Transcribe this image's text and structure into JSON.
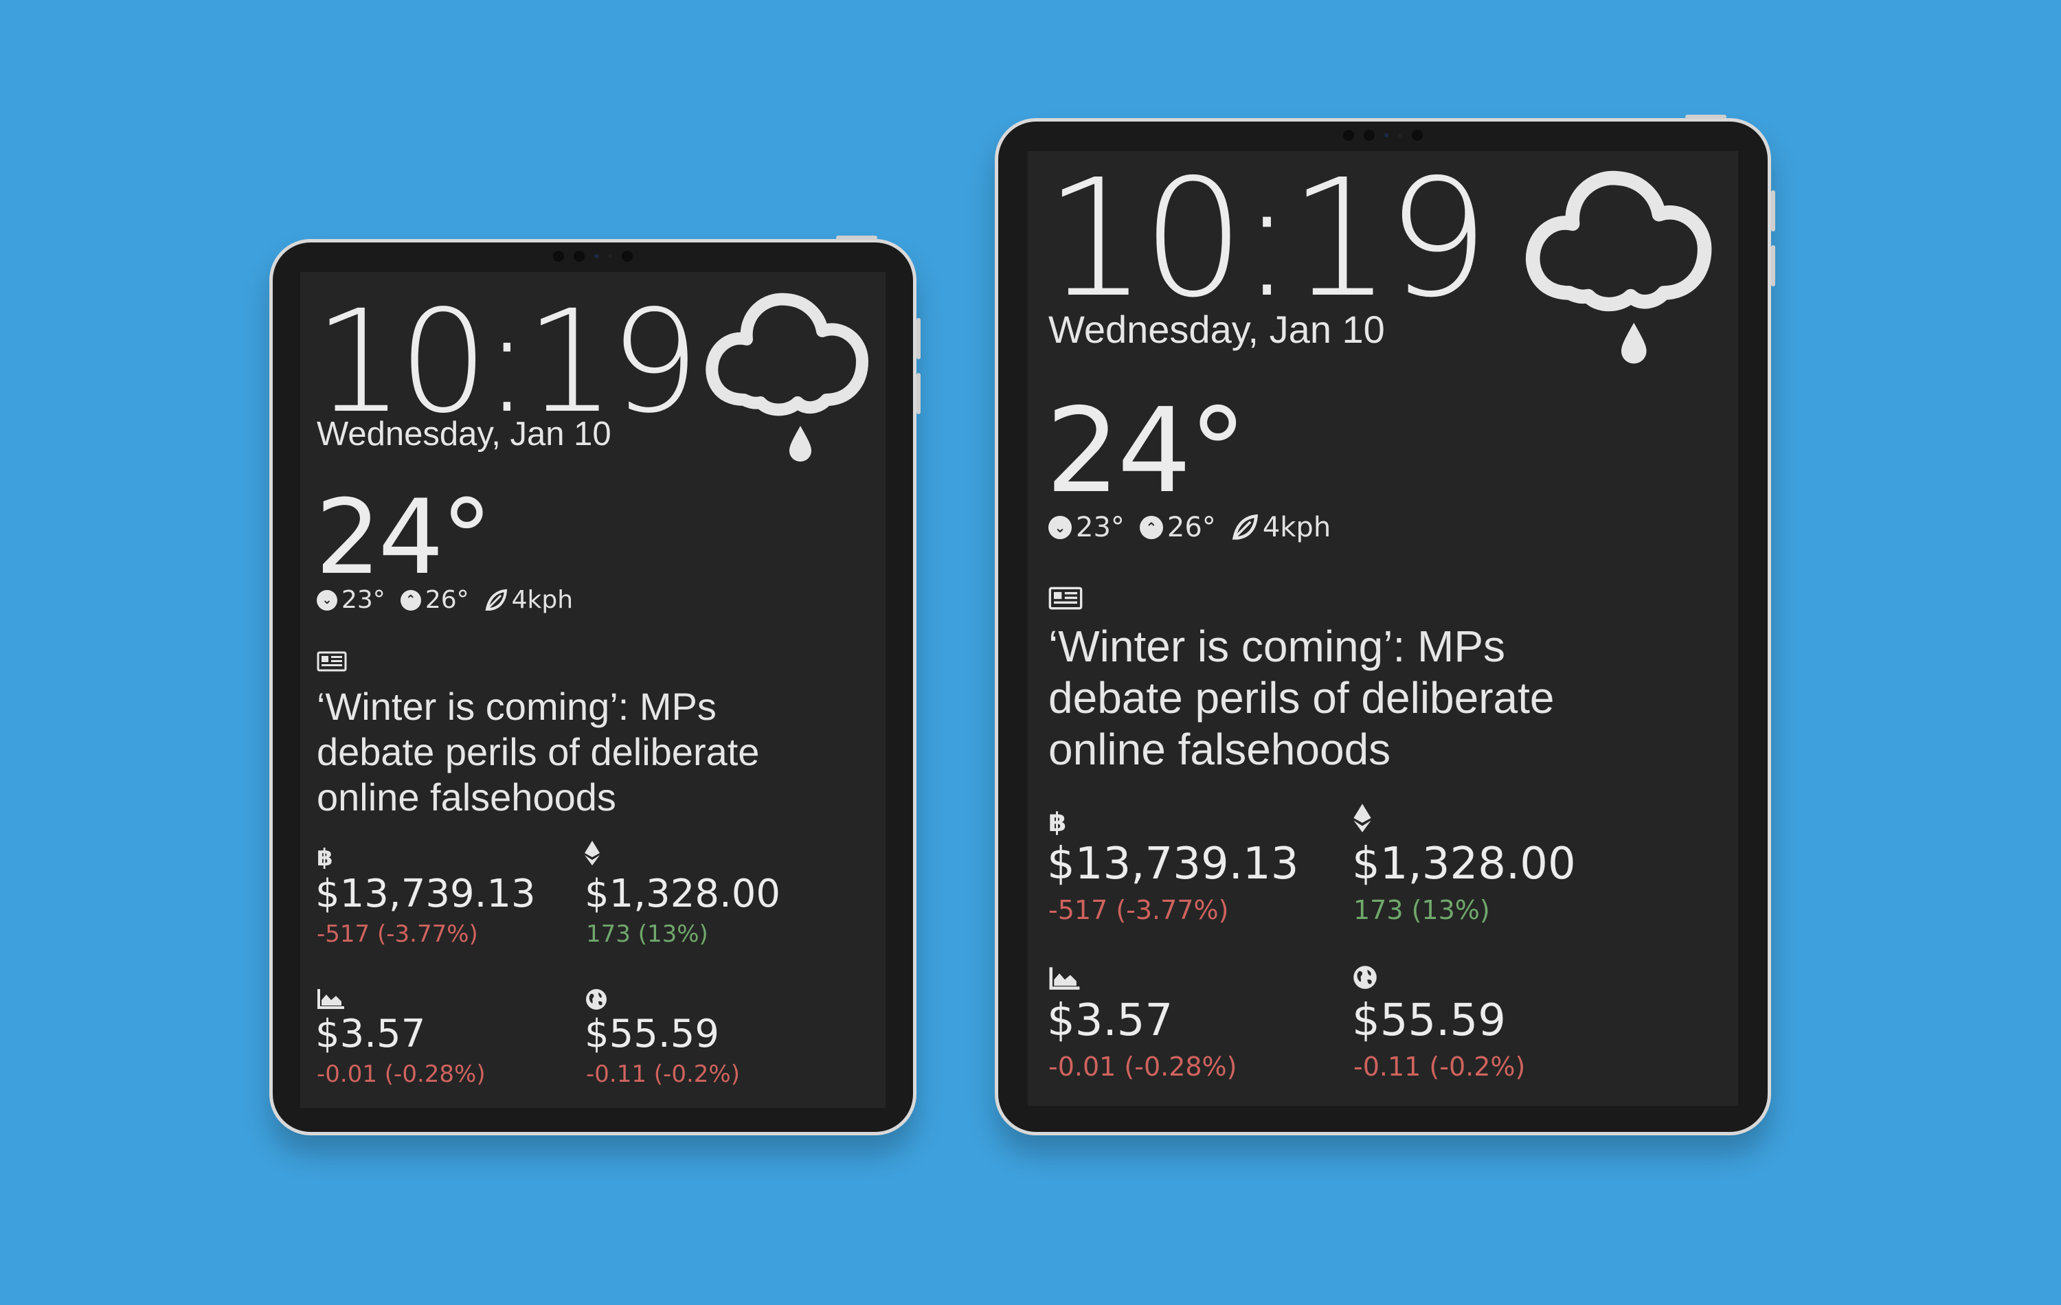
{
  "colors": {
    "background": "#3ea0dc",
    "bezel": "#1a1a1a",
    "screen": "#252525",
    "text": "#e8e8e8",
    "negative": "#d0635e",
    "positive": "#70a86c"
  },
  "dashboard": {
    "time": "10:19",
    "date": "Wednesday, Jan 10",
    "weather": {
      "icon": "cloud-rain-icon",
      "temperature": "24°",
      "low": "23°",
      "high": "26°",
      "wind": "4kph"
    },
    "news": {
      "icon": "newspaper-icon",
      "headline": "‘Winter is coming’: MPs debate perils of deliberate online falsehoods"
    },
    "tickers": [
      {
        "icon": "bitcoin-icon",
        "symbol_glyph": "฿",
        "price": "$13,739.13",
        "change": "-517 (-3.77%)",
        "direction": "negative"
      },
      {
        "icon": "ethereum-icon",
        "symbol_glyph": "◆",
        "price": "$1,328.00",
        "change": "173 (13%)",
        "direction": "positive"
      },
      {
        "icon": "area-chart-icon",
        "symbol_glyph": "",
        "price": "$3.57",
        "change": "-0.01 (-0.28%)",
        "direction": "negative"
      },
      {
        "icon": "globe-icon",
        "symbol_glyph": "",
        "price": "$55.59",
        "change": "-0.11 (-0.2%)",
        "direction": "negative"
      }
    ]
  }
}
